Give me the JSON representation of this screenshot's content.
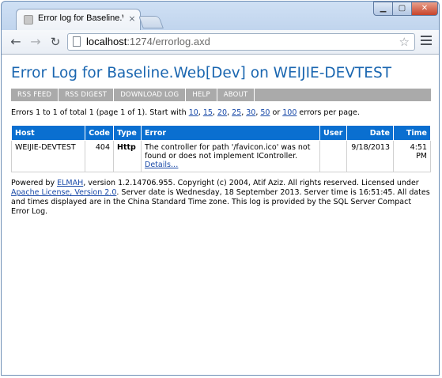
{
  "browser": {
    "tab_title": "Error log for Baseline.Web",
    "tab_close": "×",
    "url_host": "localhost",
    "url_path": ":1274/errorlog.axd"
  },
  "page": {
    "title": "Error Log for Baseline.Web[Dev] on WEIJIE-DEVTEST",
    "speedbar": [
      "RSS FEED",
      "RSS DIGEST",
      "DOWNLOAD LOG",
      "HELP",
      "ABOUT"
    ],
    "summary": {
      "prefix": "Errors 1 to 1 of total 1 (page 1 of 1). Start with ",
      "page_sizes": [
        "10",
        "15",
        "20",
        "25",
        "30",
        "50"
      ],
      "or_text": " or ",
      "last_size": "100",
      "suffix": " errors per page."
    },
    "table": {
      "headers": [
        "Host",
        "Code",
        "Type",
        "Error",
        "User",
        "Date",
        "Time"
      ],
      "rows": [
        {
          "host": "WEIJIE-DEVTEST",
          "code": "404",
          "type": "Http",
          "error": "The controller for path '/favicon.ico' was not found or does not implement IController.",
          "details": "Details…",
          "user": "",
          "date": "9/18/2013",
          "time": "4:51 PM"
        }
      ]
    },
    "footer": {
      "part1": "Powered by ",
      "elmah": "ELMAH",
      "part2": ", version 1.2.14706.955. Copyright (c) 2004, Atif Aziz. All rights reserved. Licensed under ",
      "license": "Apache License, Version 2.0",
      "part3": ". Server date is Wednesday, 18 September 2013. Server time is 16:51:45. All dates and times displayed are in the China Standard Time zone. This log is provided by the SQL Server Compact Error Log."
    }
  }
}
